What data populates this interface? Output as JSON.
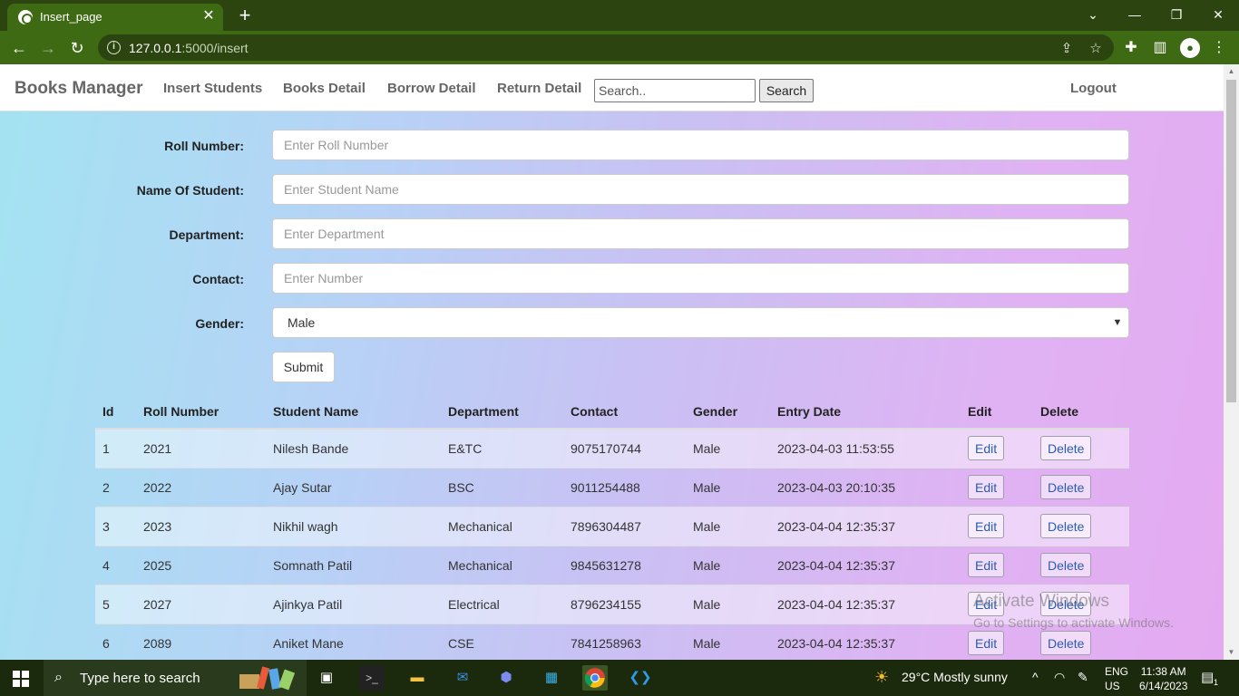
{
  "browser": {
    "tab_title": "Insert_page",
    "url_host": "127.0.0.1",
    "url_path": ":5000/insert"
  },
  "navbar": {
    "brand": "Books Manager",
    "links": [
      "Insert Students",
      "Books Detail",
      "Borrow Detail",
      "Return Detail"
    ],
    "search_placeholder": "Search..",
    "search_button": "Search",
    "logout": "Logout"
  },
  "form": {
    "roll_label": "Roll Number:",
    "roll_placeholder": "Enter Roll Number",
    "name_label": "Name Of Student:",
    "name_placeholder": "Enter Student Name",
    "dept_label": "Department:",
    "dept_placeholder": "Enter Department",
    "contact_label": "Contact:",
    "contact_placeholder": "Enter Number",
    "gender_label": "Gender:",
    "gender_selected": "Male",
    "submit": "Submit"
  },
  "table": {
    "headers": [
      "Id",
      "Roll Number",
      "Student Name",
      "Department",
      "Contact",
      "Gender",
      "Entry Date",
      "Edit",
      "Delete"
    ],
    "edit_label": "Edit",
    "delete_label": "Delete",
    "rows": [
      [
        "1",
        "2021",
        "Nilesh Bande",
        "E&TC",
        "9075170744",
        "Male",
        "2023-04-03 11:53:55"
      ],
      [
        "2",
        "2022",
        "Ajay Sutar",
        "BSC",
        "9011254488",
        "Male",
        "2023-04-03 20:10:35"
      ],
      [
        "3",
        "2023",
        "Nikhil wagh",
        "Mechanical",
        "7896304487",
        "Male",
        "2023-04-04 12:35:37"
      ],
      [
        "4",
        "2025",
        "Somnath Patil",
        "Mechanical",
        "9845631278",
        "Male",
        "2023-04-04 12:35:37"
      ],
      [
        "5",
        "2027",
        "Ajinkya Patil",
        "Electrical",
        "8796234155",
        "Male",
        "2023-04-04 12:35:37"
      ],
      [
        "6",
        "2089",
        "Aniket Mane",
        "CSE",
        "7841258963",
        "Male",
        "2023-04-04 12:35:37"
      ]
    ]
  },
  "watermark": {
    "line1": "Activate Windows",
    "line2": "Go to Settings to activate Windows."
  },
  "taskbar": {
    "search_text": "Type here to search",
    "weather": "29°C  Mostly sunny",
    "lang1": "ENG",
    "lang2": "US",
    "time": "11:38 AM",
    "date": "6/14/2023",
    "notification_count": "1"
  },
  "colors": {
    "chrome_tab_strip": "#2c4510",
    "chrome_toolbar": "#3f6a14",
    "taskbar": "#1b2a0d"
  }
}
